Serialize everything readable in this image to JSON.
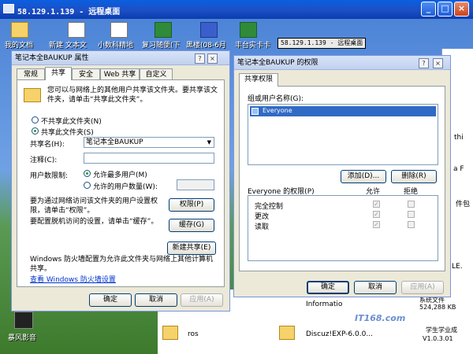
{
  "remote_window": {
    "title": "58.129.1.139 - 远程桌面",
    "minimize": "_",
    "maximize": "□",
    "close": "×"
  },
  "inner_rd_bar": {
    "title": "58.129.1.139 - 远程桌面"
  },
  "desktop": {
    "icons": [
      "我的文档",
      "新建 文本文",
      "小数科精地",
      "复习随便(下",
      "黑楼(08-6月",
      "丰台实卡卡"
    ],
    "bottom_left": "暴风影音",
    "right_fragments": [
      "thi",
      "a F",
      "件包",
      "LE.",
      "系统文件",
      "524,288 KB"
    ],
    "files": [
      "ros",
      "Discuz!EXP-6.0.0...",
      "Informatio",
      "学生学业成",
      "V1.0.3.01"
    ],
    "watermark": "IT168.com"
  },
  "properties": {
    "title": "笔记本全BAUKUP 属性",
    "tabs": [
      "常规",
      "共享",
      "安全",
      "Web 共享",
      "自定义"
    ],
    "active_tab": 1,
    "description": "您可以与网络上的其他用户共享该文件夹。要共享该文件夹，请单击“共享此文件夹”。",
    "no_share": "不共享此文件夹(N)",
    "share": "共享此文件夹(S)",
    "share_name_label": "共享名(H):",
    "share_name_value": "笔记本全BAUKUP",
    "comment_label": "注释(C):",
    "comment_value": "",
    "user_limit_label": "用户数限制:",
    "max_allowed": "允许最多用户(M)",
    "allowed_count": "允许的用户数量(W):",
    "perm_desc": "要为通过网络访问该文件夹的用户设置权限，请单击“权限”。",
    "perm_button": "权限(P)",
    "cache_desc": "要配置脱机访问的设置，请单击“缓存”。",
    "cache_button": "缓存(G)",
    "new_share": "新建共享(E)",
    "firewall_text": "Windows 防火墙配置为允许此文件夹与网络上其他计算机共享。",
    "firewall_link": "查看 Windows 防火墙设置",
    "ok": "确定",
    "cancel": "取消",
    "apply": "应用(A)"
  },
  "permissions": {
    "title": "笔记本全BAUKUP 的权限",
    "tab": "共享权限",
    "group_label": "组或用户名称(G):",
    "users": [
      "Everyone"
    ],
    "add": "添加(D)...",
    "remove": "删除(R)",
    "perm_label": "Everyone 的权限(P)",
    "col_allow": "允许",
    "col_deny": "拒绝",
    "rows": [
      {
        "name": "完全控制",
        "allow": true,
        "deny": false
      },
      {
        "name": "更改",
        "allow": true,
        "deny": false
      },
      {
        "name": "读取",
        "allow": true,
        "deny": false
      }
    ],
    "ok": "确定",
    "cancel": "取消",
    "apply": "应用(A)"
  }
}
